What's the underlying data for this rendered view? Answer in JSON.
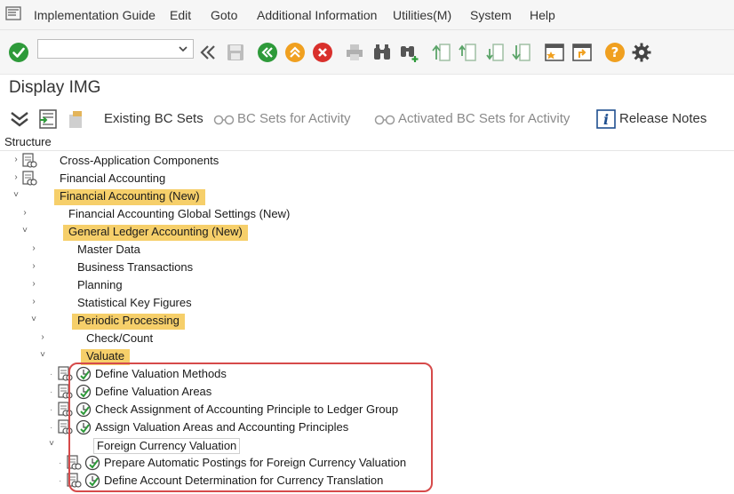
{
  "menubar": {
    "items": [
      "Implementation Guide",
      "Edit",
      "Goto",
      "Additional Information",
      "Utilities(M)",
      "System",
      "Help"
    ]
  },
  "toolbar": {
    "command_value": "",
    "icons": [
      "enter-check-icon",
      "back-double-icon",
      "save-icon",
      "back-icon",
      "exit-icon",
      "cancel-icon",
      "print-icon",
      "find-icon",
      "find-next-icon",
      "first-page-icon",
      "previous-page-icon",
      "next-page-icon",
      "last-page-icon",
      "new-window-icon",
      "shortcut-icon",
      "help-icon",
      "settings-gear-icon"
    ]
  },
  "title": "Display IMG",
  "app_toolbar": {
    "existing_bc_sets": "Existing BC Sets",
    "bc_sets_for_activity": "BC Sets for Activity",
    "activated_bc_sets": "Activated BC Sets for Activity",
    "release_notes": "Release Notes"
  },
  "structure_header": "Structure",
  "tree": [
    {
      "label": "Cross-Application Components",
      "level": 0,
      "expander": "›",
      "highlight": false
    },
    {
      "label": "Financial Accounting",
      "level": 0,
      "expander": "›",
      "highlight": false
    },
    {
      "label": "Financial Accounting (New)",
      "level": 0,
      "expander": "˅",
      "highlight": true
    },
    {
      "label": "Financial Accounting Global Settings (New)",
      "level": 1,
      "expander": "›",
      "highlight": false
    },
    {
      "label": "General Ledger Accounting (New)",
      "level": 1,
      "expander": "˅",
      "highlight": true
    },
    {
      "label": "Master Data",
      "level": 2,
      "expander": "›",
      "highlight": false
    },
    {
      "label": "Business Transactions",
      "level": 2,
      "expander": "›",
      "highlight": false
    },
    {
      "label": "Planning",
      "level": 2,
      "expander": "›",
      "highlight": false
    },
    {
      "label": "Statistical Key Figures",
      "level": 2,
      "expander": "›",
      "highlight": false
    },
    {
      "label": "Periodic Processing",
      "level": 2,
      "expander": "˅",
      "highlight": true
    },
    {
      "label": "Check/Count",
      "level": 3,
      "expander": "›",
      "highlight": false
    },
    {
      "label": "Valuate",
      "level": 3,
      "expander": "˅",
      "highlight": true
    },
    {
      "label": "Define Valuation Methods",
      "level": 4,
      "activity": true
    },
    {
      "label": "Define Valuation Areas",
      "level": 4,
      "activity": true
    },
    {
      "label": "Check Assignment of Accounting Principle to Ledger Group",
      "level": 4,
      "activity": true
    },
    {
      "label": "Assign Valuation Areas and Accounting Principles",
      "level": 4,
      "activity": true
    },
    {
      "label": "Foreign Currency Valuation",
      "level": 4,
      "expander": "˅",
      "boxed": true
    },
    {
      "label": "Prepare Automatic Postings for Foreign Currency Valuation",
      "level": 5,
      "activity": true
    },
    {
      "label": "Define Account Determination for Currency Translation",
      "level": 5,
      "activity": true
    }
  ],
  "colors": {
    "highlight": "#f6cf6a",
    "red_box": "#d64a4a",
    "enter_green": "#2e9a3a",
    "nav_orange": "#f0a020",
    "cancel_red": "#d9302c"
  }
}
